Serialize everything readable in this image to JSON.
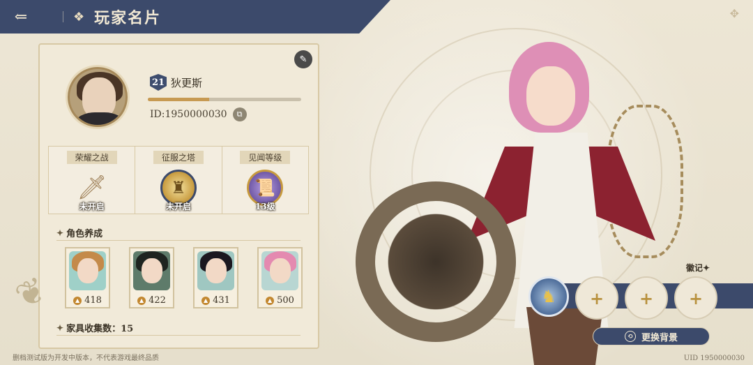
{
  "header": {
    "back_icon": "back-arrow-icon",
    "title_icon": "menu-grid-icon",
    "title": "玩家名片"
  },
  "profile": {
    "level": "21",
    "name": "狄更斯",
    "exp_fraction": 0.4,
    "id_text": "ID:1950000030"
  },
  "stats": [
    {
      "title": "荣耀之战",
      "value": "未开启",
      "icon": "sword-icon"
    },
    {
      "title": "征服之塔",
      "value": "未开启",
      "icon": "tower-icon"
    },
    {
      "title": "见闻等级",
      "value": "13级",
      "icon": "scroll-icon"
    }
  ],
  "characters": {
    "section_title": "角色养成",
    "items": [
      {
        "power": "418"
      },
      {
        "power": "422"
      },
      {
        "power": "431"
      },
      {
        "power": "500"
      }
    ]
  },
  "furniture": {
    "label": "家具收集数：15"
  },
  "emblem": {
    "label": "徽记",
    "slot_symbol": "+"
  },
  "change_bg_button": "更换背景",
  "footer": {
    "note": "删档测试版为开发中版本，不代表游戏最终品质",
    "uid": "UID 1950000030"
  },
  "colors": {
    "navy": "#3c4a6b",
    "parchment": "#ebe4d3",
    "gold": "#c79a52"
  }
}
